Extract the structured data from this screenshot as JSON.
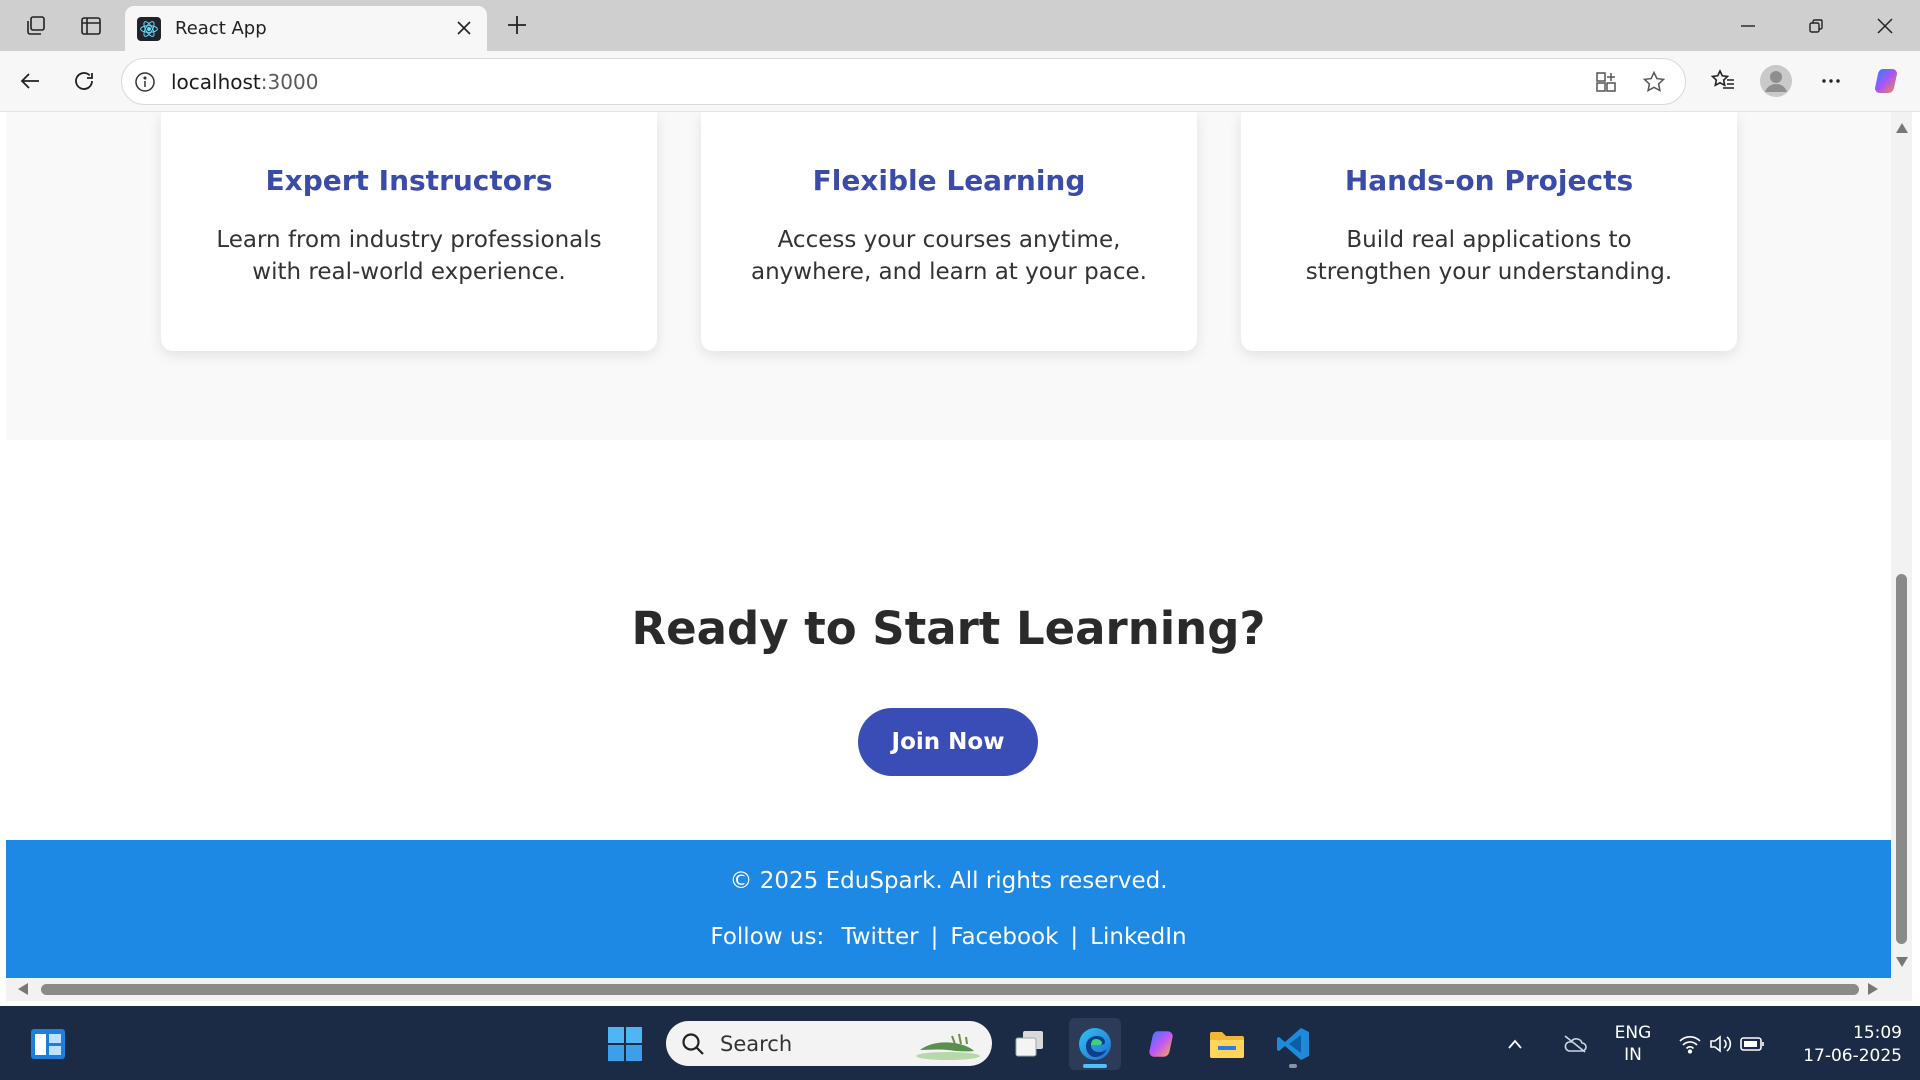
{
  "browser": {
    "tab_title": "React App",
    "address": {
      "host": "localhost",
      "port": ":3000"
    }
  },
  "features": [
    {
      "title": "Expert Instructors",
      "description": "Learn from industry professionals with real-world experience."
    },
    {
      "title": "Flexible Learning",
      "description": "Access your courses anytime, anywhere, and learn at your pace."
    },
    {
      "title": "Hands-on Projects",
      "description": "Build real applications to strengthen your understanding."
    }
  ],
  "cta": {
    "heading": "Ready to Start Learning?",
    "button_label": "Join Now"
  },
  "footer": {
    "copyright": "© 2025 EduSpark. All rights reserved.",
    "follow_label": "Follow us:",
    "links": [
      "Twitter",
      "Facebook",
      "LinkedIn"
    ],
    "separator": "|"
  },
  "taskbar": {
    "search_placeholder": "Search",
    "language": "ENG",
    "region": "IN",
    "time": "15:09",
    "date": "17-06-2025"
  },
  "colors": {
    "accent": "#3b4ba8",
    "button": "#3a4cb5",
    "footer": "#1e88e5",
    "taskbar": "#1c2b45"
  },
  "icons": [
    "workspaces-icon",
    "tab-actions-icon",
    "react-icon",
    "close-icon",
    "plus-icon",
    "minimize-icon",
    "restore-icon",
    "back-icon",
    "refresh-icon",
    "info-icon",
    "app-available-icon",
    "star-icon",
    "favorites-icon",
    "profile-icon",
    "more-icon",
    "copilot-icon",
    "windows-start-icon",
    "search-icon",
    "task-view-icon",
    "edge-icon",
    "file-explorer-icon",
    "vscode-icon",
    "chevron-up-icon",
    "cloud-icon",
    "wifi-icon",
    "volume-icon",
    "battery-icon"
  ]
}
